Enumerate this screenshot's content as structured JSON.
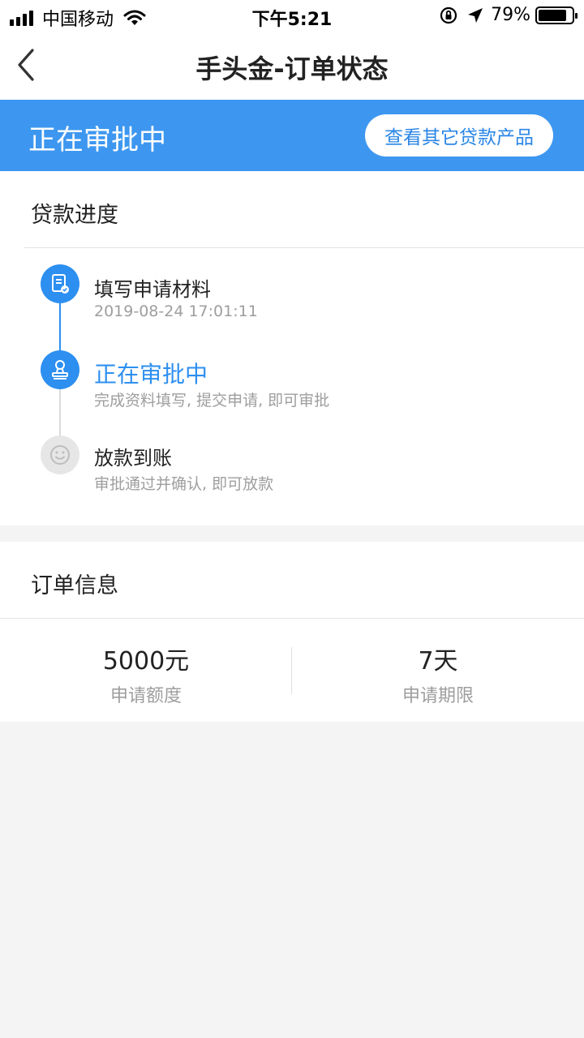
{
  "status_bar": {
    "carrier": "中国移动",
    "time": "下午5:21",
    "battery": "79%"
  },
  "nav": {
    "title": "手头金-订单状态",
    "back_icon": "chevron-left-icon"
  },
  "banner": {
    "status": "正在审批中",
    "button_label": "查看其它贷款产品"
  },
  "progress": {
    "section_title": "贷款进度",
    "steps": [
      {
        "title": "填写申请材料",
        "subtitle": "2019-08-24 17:01:11",
        "icon": "document-check-icon",
        "state": "done"
      },
      {
        "title": "正在审批中",
        "subtitle": "完成资料填写, 提交申请, 即可审批",
        "icon": "stamp-icon",
        "state": "active"
      },
      {
        "title": "放款到账",
        "subtitle": "审批通过并确认, 即可放款",
        "icon": "smiley-icon",
        "state": "pending"
      }
    ]
  },
  "order": {
    "section_title": "订单信息",
    "amount_value": "5000元",
    "amount_label": "申请额度",
    "term_value": "7天",
    "term_label": "申请期限"
  },
  "colors": {
    "accent": "#3d97f0",
    "step_active": "#2d8ff0",
    "muted_text": "#9e9e9e"
  }
}
